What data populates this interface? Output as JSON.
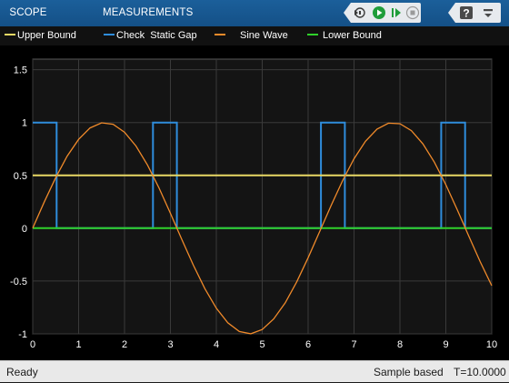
{
  "toolstrip": {
    "tabs": [
      "SCOPE",
      "MEASUREMENTS"
    ],
    "buttons": [
      "step-back-icon",
      "run-icon",
      "step-forward-icon",
      "stop-icon",
      "help-icon",
      "minimize-icon"
    ]
  },
  "legend": {
    "items": [
      {
        "label": "Upper Bound",
        "color": "#e8d864"
      },
      {
        "label": "Check  Static Gap",
        "color": "#2f8ddc"
      },
      {
        "label": "Sine Wave",
        "color": "#f08a2a"
      },
      {
        "label": "Lower Bound",
        "color": "#2fd02a"
      }
    ]
  },
  "status": {
    "ready": "Ready",
    "mode": "Sample based",
    "time": "T=10.0000"
  },
  "chart_data": {
    "type": "line",
    "xlim": [
      0,
      10
    ],
    "ylim": [
      -1,
      1.6
    ],
    "xticks": [
      "0",
      "1",
      "2",
      "3",
      "4",
      "5",
      "6",
      "7",
      "8",
      "9",
      "10"
    ],
    "yticks": [
      "-1",
      "-0.5",
      "0",
      "0.5",
      "1",
      "1.5"
    ],
    "grid": true,
    "series": [
      {
        "name": "Upper Bound",
        "color": "#e8d864",
        "x": [
          0,
          10
        ],
        "y": [
          0.5,
          0.5
        ]
      },
      {
        "name": "Check  Static Gap",
        "color": "#2f8ddc",
        "x": [
          0,
          0.52,
          0.52,
          2.62,
          2.62,
          3.14,
          3.14,
          6.28,
          6.28,
          6.8,
          6.8,
          8.9,
          8.9,
          9.42,
          9.42,
          10
        ],
        "y": [
          1,
          1,
          0,
          0,
          1,
          1,
          0,
          0,
          1,
          1,
          0,
          0,
          1,
          1,
          0,
          0
        ]
      },
      {
        "name": "Sine Wave",
        "color": "#f08a2a",
        "x": [
          0,
          0.25,
          0.5,
          0.75,
          1,
          1.25,
          1.5,
          1.75,
          2,
          2.25,
          2.5,
          2.75,
          3,
          3.25,
          3.5,
          3.75,
          4,
          4.25,
          4.5,
          4.75,
          5,
          5.25,
          5.5,
          5.75,
          6,
          6.25,
          6.5,
          6.75,
          7,
          7.25,
          7.5,
          7.75,
          8,
          8.25,
          8.5,
          8.75,
          9,
          9.25,
          9.5,
          9.75,
          10
        ],
        "y": [
          0,
          0.247,
          0.479,
          0.682,
          0.841,
          0.949,
          0.997,
          0.984,
          0.909,
          0.778,
          0.598,
          0.382,
          0.141,
          -0.108,
          -0.351,
          -0.572,
          -0.757,
          -0.895,
          -0.978,
          -0.999,
          -0.959,
          -0.859,
          -0.706,
          -0.508,
          -0.279,
          -0.033,
          0.215,
          0.45,
          0.657,
          0.823,
          0.938,
          0.994,
          0.989,
          0.923,
          0.798,
          0.625,
          0.412,
          0.174,
          -0.075,
          -0.319,
          -0.544
        ]
      },
      {
        "name": "Lower Bound",
        "color": "#2fd02a",
        "x": [
          0,
          10
        ],
        "y": [
          0,
          0
        ]
      }
    ]
  }
}
